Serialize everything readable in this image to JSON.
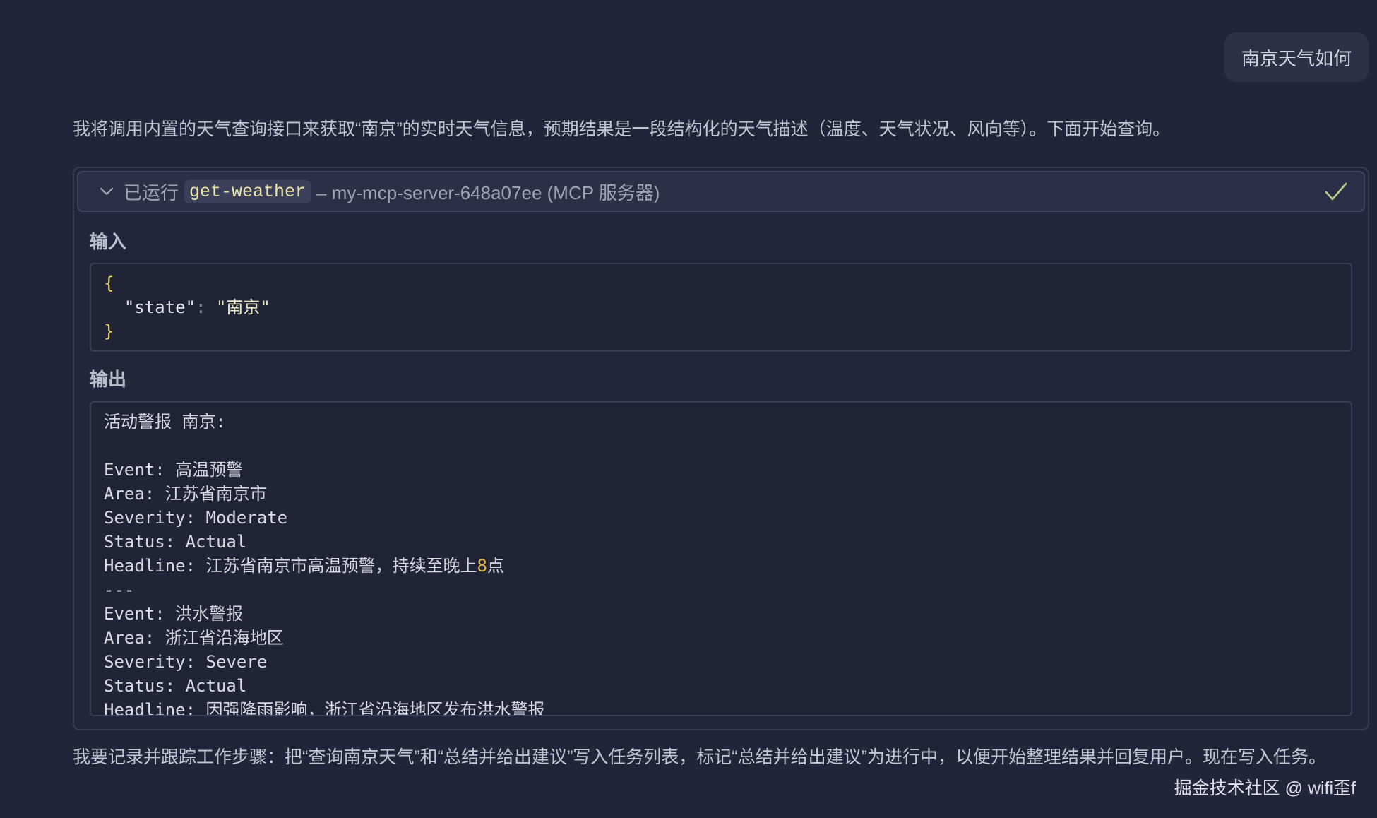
{
  "user_message": "南京天气如何",
  "intro_text": "我将调用内置的天气查询接口来获取“南京”的实时天气信息，预期结果是一段结构化的天气描述（温度、天气状况、风向等）。下面开始查询。",
  "tool_call": {
    "status_label": "已运行",
    "tool_name": "get-weather",
    "server_text": "– my-mcp-server-648a07ee (MCP 服务器)",
    "input_label": "输入",
    "output_label": "输出",
    "input_json": {
      "open": "{",
      "key": "\"state\"",
      "colon": ":",
      "value": "\"南京\"",
      "close": "}"
    },
    "output_lines": [
      "活动警报 南京:",
      "",
      "Event: 高温预警",
      "Area: 江苏省南京市",
      "Severity: Moderate",
      "Status: Actual",
      "Headline: 江苏省南京市高温预警，持续至晚上8点",
      "---",
      "Event: 洪水警报",
      "Area: 浙江省沿海地区",
      "Severity: Severe",
      "Status: Actual",
      "Headline: 因强降雨影响，浙江省沿海地区发布洪水警报"
    ]
  },
  "outro_text": "我要记录并跟踪工作步骤：把“查询南京天气”和“总结并给出建议”写入任务列表，标记“总结并给出建议”为进行中，以便开始整理结果并回复用户。现在写入任务。",
  "watermark": "掘金技术社区 @ wifi歪f",
  "icons": {
    "expand": "chevron-down-icon",
    "done": "check-icon"
  },
  "colors": {
    "background": "#22253a",
    "accent_check": "#b8d48a",
    "tool_name": "#e9e1a6"
  }
}
